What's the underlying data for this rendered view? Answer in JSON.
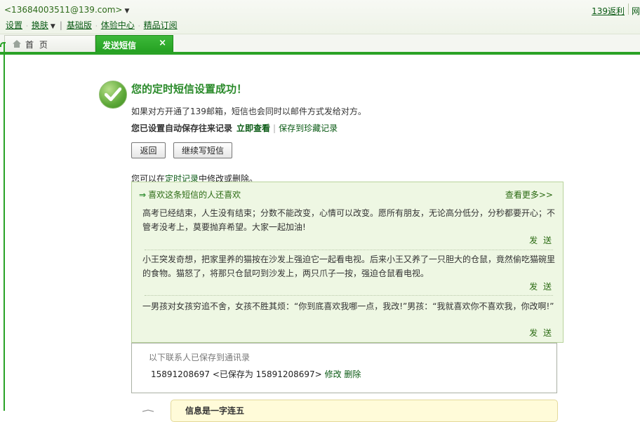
{
  "header": {
    "account": "<13684003511@139.com>",
    "right_link": "139返利",
    "right_link2": "网",
    "menu": [
      "设置",
      "换肤",
      "基础版",
      "体验中心",
      "精品订阅"
    ]
  },
  "tabs": [
    {
      "label": "首 页"
    },
    {
      "label": "发送短信",
      "close": "×"
    }
  ],
  "success": {
    "title": "您的定时短信设置成功！",
    "desc": "如果对方开通了139邮箱，短信也会同时以邮件方式发给对方。",
    "autosave_text": "您已设置自动保存往来记录",
    "view_now": "立即查看",
    "save_fav": "保存到珍藏记录"
  },
  "buttons": {
    "back": "返回",
    "continue": "继续写短信"
  },
  "modify": {
    "prefix": "您可以在",
    "link": "定时记录",
    "suffix": "中修改或删除。"
  },
  "recommend": {
    "title": "喜欢这条短信的人还喜欢",
    "more": "查看更多>>",
    "send_label": "发 送",
    "messages": [
      "高考已经结束，人生没有结束；分数不能改变，心情可以改变。愿所有朋友，无论高分低分，分秒都要开心；不管考没考上，莫要抛弃希望。大家一起加油!",
      "小王突发奇想，把家里养的猫按在沙发上强迫它一起看电视。后来小王又养了一只胆大的仓鼠，竟然偷吃猫碗里的食物。猫怒了，将那只仓鼠叼到沙发上，两只爪子一按，强迫仓鼠看电视。",
      "一男孩对女孩穷追不舍，女孩不胜其烦：“你到底喜欢我哪一点，我改!”男孩：“我就喜欢你不喜欢我，你改啊!”"
    ]
  },
  "contacts": {
    "title": "以下联系人已保存到通讯录",
    "number": "15891208697",
    "saved_as": "<已保存为 15891208697>",
    "edit": "修改",
    "delete": "删除"
  },
  "bottom_hint": "信息是一字连五",
  "colors": {
    "brand_green": "#2aa226",
    "link_green": "#0a5a14",
    "panel_bg": "#eef7e3"
  }
}
